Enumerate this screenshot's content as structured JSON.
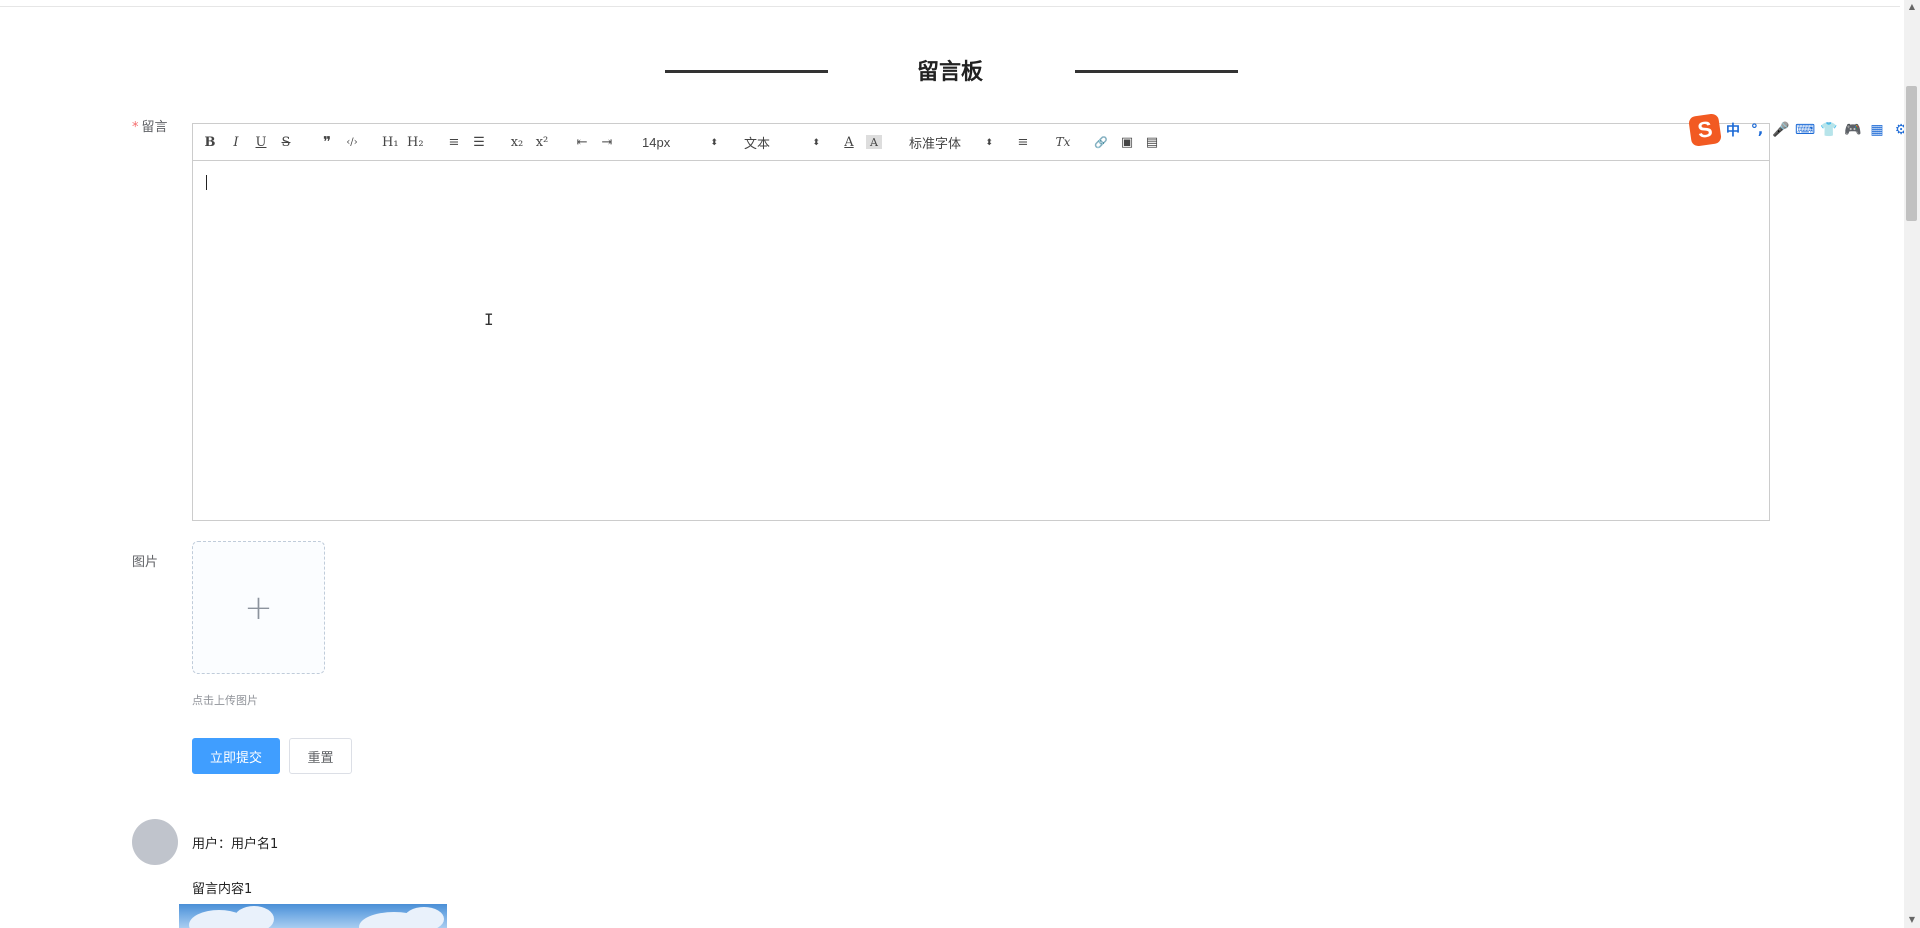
{
  "title": "留言板",
  "form": {
    "message_label": "留言",
    "required_mark": "*",
    "image_label": "图片",
    "upload_tip": "点击上传图片",
    "upload_plus": "+",
    "submit_label": "立即提交",
    "reset_label": "重置"
  },
  "toolbar": {
    "bold": "B",
    "italic": "I",
    "underline": "U",
    "strike": "S",
    "blockquote": "❞",
    "code": "‹/›",
    "h1": "H₁",
    "h2": "H₂",
    "ordered_list": "≡",
    "bullet_list": "☰",
    "subscript": "x₂",
    "superscript": "x²",
    "outdent": "⇤",
    "indent": "⇥",
    "size_value": "14px",
    "header_value": "文本",
    "color": "A",
    "background": "A",
    "font_value": "标准字体",
    "align": "≡",
    "clean": "Tx",
    "link": "🔗",
    "image": "▣",
    "video": "▤",
    "caret": "⬍"
  },
  "messages": [
    {
      "user": "用户：用户名1",
      "content": "留言内容1"
    }
  ],
  "ime": {
    "logo": "S",
    "items": [
      "中",
      "°,",
      "🎤",
      "⌨",
      "👕",
      "🎮",
      "▦",
      "⚙"
    ]
  },
  "colors": {
    "primary": "#409eff",
    "required": "#f56c6c",
    "ime_brand": "#f25a22",
    "ime_icon": "#1c6ad6"
  }
}
